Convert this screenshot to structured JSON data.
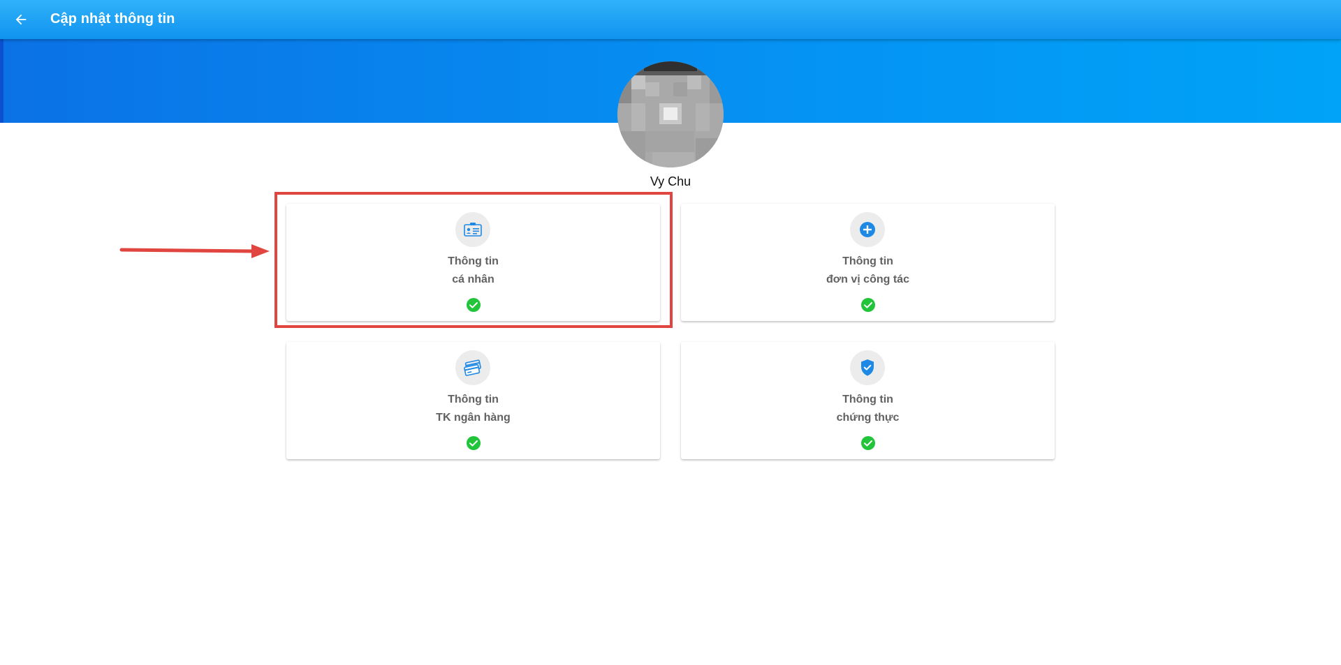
{
  "appbar": {
    "title": "Cập nhật thông tin",
    "back_icon": "arrow-left-icon"
  },
  "profile": {
    "name": "Vy Chu"
  },
  "cards": [
    {
      "line1": "Thông tin",
      "line2": "cá nhân",
      "icon": "id-card-icon",
      "status": "check-circle-icon"
    },
    {
      "line1": "Thông tin",
      "line2": "đơn vị công tác",
      "icon": "plus-circle-icon",
      "status": "check-circle-icon"
    },
    {
      "line1": "Thông tin",
      "line2": "TK ngân hàng",
      "icon": "bank-cards-icon",
      "status": "check-circle-icon"
    },
    {
      "line1": "Thông tin",
      "line2": "chứng thực",
      "icon": "shield-check-icon",
      "status": "check-circle-icon"
    }
  ],
  "colors": {
    "appbar": "#1ea3f5",
    "banner": "#0593f3",
    "card_icon": "#1e88e5",
    "check": "#22c43a",
    "annotation": "#e0463f"
  }
}
